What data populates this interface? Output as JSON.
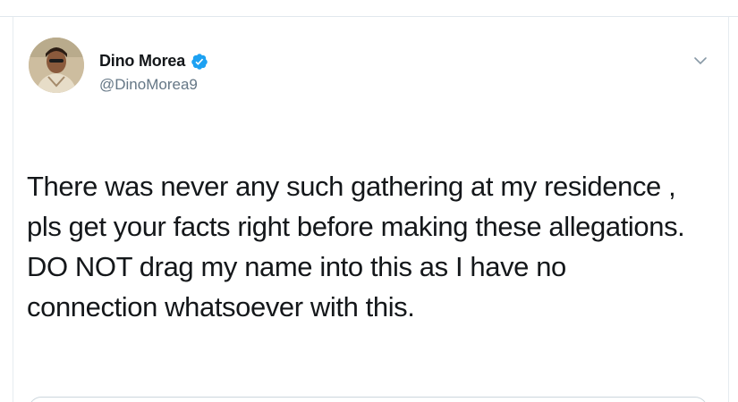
{
  "tweet": {
    "author": {
      "display_name": "Dino Morea",
      "handle": "@DinoMorea9",
      "verified": true
    },
    "text_lines": [
      "There was never any such gathering at my residence ,",
      "pls get your facts right before making these allegations.",
      "DO NOT drag my name into this as I have no",
      "connection whatsoever with this."
    ]
  },
  "icons": {
    "verified": "verified-badge-icon",
    "menu": "chevron-down-icon"
  },
  "colors": {
    "text": "#14171a",
    "secondary": "#657786",
    "verified_blue": "#1da1f2",
    "border": "#e6ecf0"
  }
}
